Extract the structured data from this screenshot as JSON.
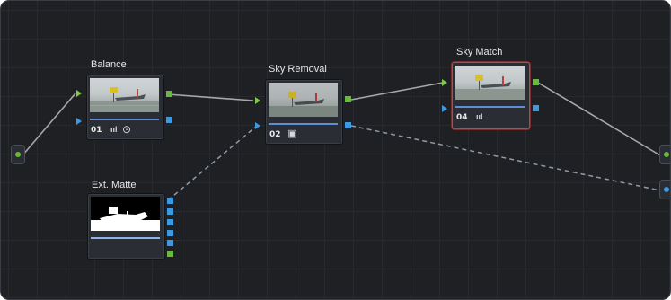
{
  "colors": {
    "background": "#1e2024",
    "rgb_link": "#a8a8a8",
    "key_link": "#8f9aa6",
    "rgb_port": "#69b93b",
    "key_port": "#3c9be0",
    "selected_border": "#b54a4a"
  },
  "nodes": [
    {
      "id": "balance",
      "title": "Balance",
      "number": "01",
      "icons": [
        "levels-icon",
        "circle-target-icon"
      ]
    },
    {
      "id": "sky_removal",
      "title": "Sky Removal",
      "number": "02",
      "icons": [
        "qualifier-icon"
      ]
    },
    {
      "id": "sky_match",
      "title": "Sky Match",
      "number": "04",
      "icons": [
        "levels-icon"
      ],
      "selected": true
    },
    {
      "id": "ext_matte",
      "title": "Ext. Matte",
      "number": "",
      "icons": []
    }
  ],
  "glyphs": {
    "levels": "ııl",
    "target": "⊙",
    "qualifier": "▣"
  }
}
